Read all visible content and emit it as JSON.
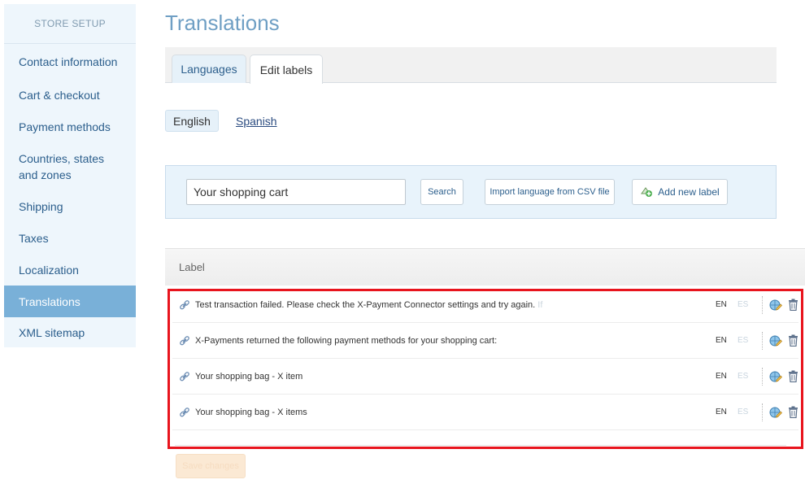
{
  "sidebar": {
    "header": "STORE SETUP",
    "items": [
      {
        "label": "Contact information"
      },
      {
        "label": "Cart & checkout"
      },
      {
        "label": "Payment methods"
      },
      {
        "label": "Countries, states and zones"
      },
      {
        "label": "Shipping"
      },
      {
        "label": "Taxes"
      },
      {
        "label": "Localization"
      },
      {
        "label": "Translations"
      },
      {
        "label": "XML sitemap"
      }
    ],
    "active_item": "Translations"
  },
  "page": {
    "title": "Translations"
  },
  "tabs": [
    {
      "label": "Languages"
    },
    {
      "label": "Edit labels"
    }
  ],
  "languages": {
    "current": "English",
    "other": "Spanish"
  },
  "search": {
    "value": "Your shopping cart",
    "search_label": "Search",
    "import_label": "Import language from CSV file",
    "add_label": "Add new label"
  },
  "table": {
    "header": "Label",
    "rows": [
      {
        "text": "Test transaction failed. Please check the X-Payment Connector settings and try again.",
        "overflow": "If",
        "lang1": "EN",
        "lang2": "ES"
      },
      {
        "text": "X-Payments returned the following payment methods for your shopping cart:",
        "lang1": "EN",
        "lang2": "ES"
      },
      {
        "text": "Your shopping bag - X item",
        "lang1": "EN",
        "lang2": "ES"
      },
      {
        "text": "Your shopping bag - X items",
        "lang1": "EN",
        "lang2": "ES"
      }
    ]
  },
  "footer": {
    "save_label": "Save changes"
  },
  "colors": {
    "accent": "#6f9fc4",
    "sidebar_bg": "#eef6fc",
    "sidebar_active": "#79b0d8",
    "highlight": "#e8141d"
  }
}
